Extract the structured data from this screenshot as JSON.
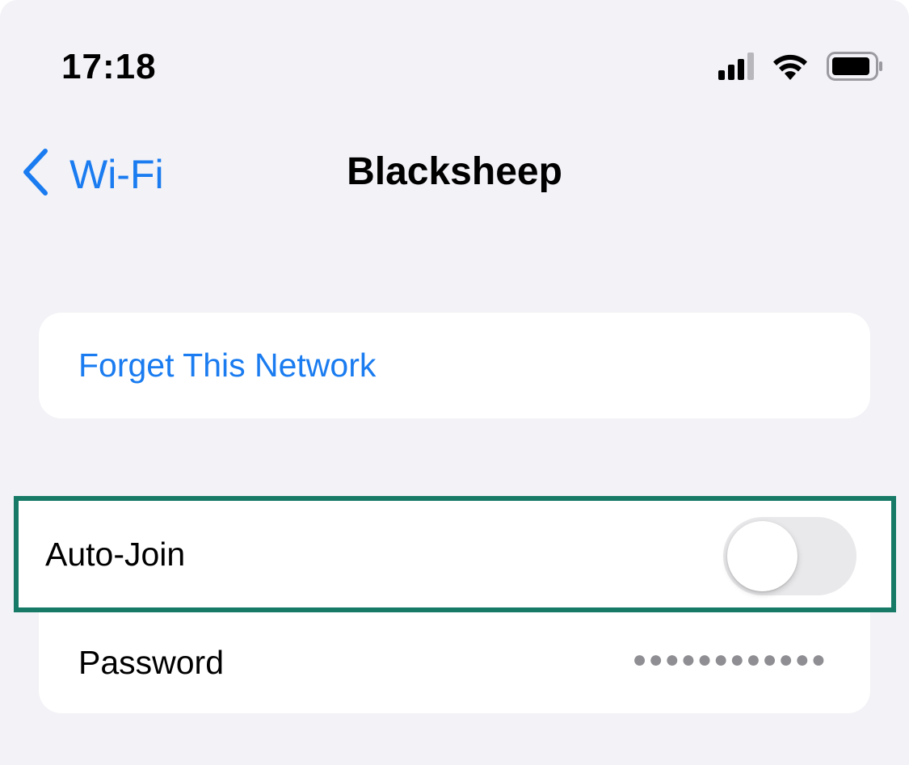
{
  "status_bar": {
    "time": "17:18",
    "icons": [
      "cellular-signal-icon",
      "wifi-icon",
      "battery-icon"
    ]
  },
  "nav": {
    "back_label": "Wi-Fi",
    "title": "Blacksheep"
  },
  "actions": {
    "forget_label": "Forget This Network"
  },
  "settings": {
    "auto_join_label": "Auto-Join",
    "auto_join_on": false,
    "password_label": "Password",
    "password_value": "●●●●●●●●●●●●"
  },
  "colors": {
    "accent": "#1a7cf0",
    "background": "#f2f2f7",
    "highlight": "#167a67",
    "toggle_off": "#e9e9eb",
    "secondary_text": "#8e8e93"
  }
}
